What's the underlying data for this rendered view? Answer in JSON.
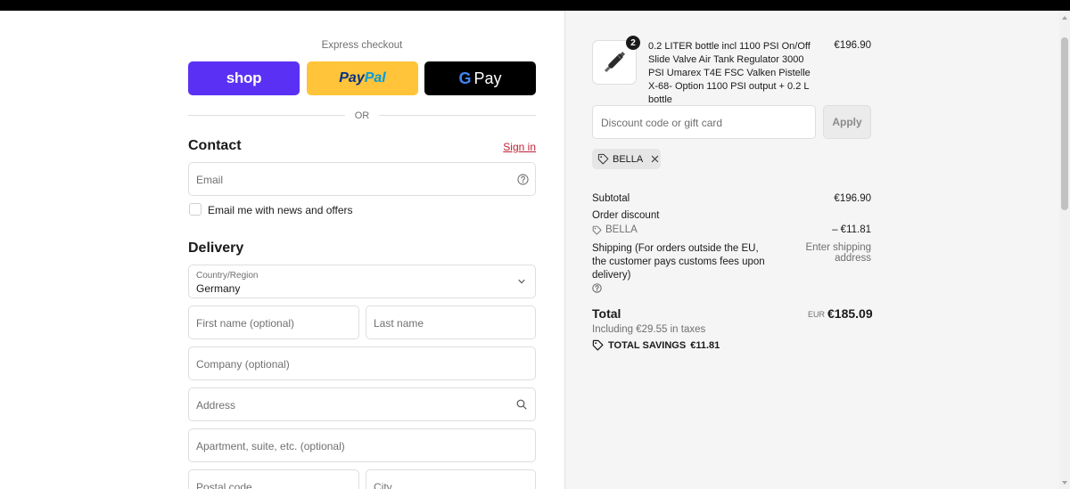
{
  "express": {
    "label": "Express checkout",
    "shop_label": "shop",
    "paypal_part1": "Pay",
    "paypal_part2": "Pal",
    "gpay_label": "Pay",
    "or_text": "OR"
  },
  "contact": {
    "title": "Contact",
    "signin_label": "Sign in",
    "email_placeholder": "Email",
    "newsletter_label": "Email me with news and offers"
  },
  "delivery": {
    "title": "Delivery",
    "country_caption": "Country/Region",
    "country_value": "Germany",
    "first_name_placeholder": "First name (optional)",
    "last_name_placeholder": "Last name",
    "company_placeholder": "Company (optional)",
    "address_placeholder": "Address",
    "apartment_placeholder": "Apartment, suite, etc. (optional)",
    "postal_placeholder": "Postal code",
    "city_placeholder": "City"
  },
  "order": {
    "item": {
      "quantity": "2",
      "title": "0.2 LITER bottle incl 1100 PSI On/Off Slide Valve Air Tank Regulator 3000 PSI Umarex T4E FSC Valken Pistelle X-68- Option 1100 PSI output + 0.2 L bottle",
      "price": "€196.90"
    },
    "discount_placeholder": "Discount code or gift card",
    "apply_label": "Apply",
    "applied_code": "BELLA",
    "subtotal_label": "Subtotal",
    "subtotal_value": "€196.90",
    "order_discount_label": "Order discount",
    "discount_code": "BELLA",
    "discount_value": "– €11.81",
    "shipping_label": "Shipping (For orders outside the EU, the customer pays customs fees upon delivery)",
    "shipping_value": "Enter shipping address",
    "total_label": "Total",
    "total_currency": "EUR",
    "total_value": "€185.09",
    "tax_note": "Including €29.55 in taxes",
    "savings_label": "TOTAL SAVINGS",
    "savings_value": "€11.81"
  },
  "colors": {
    "shop_brand": "#5a31f4",
    "paypal_yellow": "#ffc439",
    "link_red": "#c11f34"
  }
}
